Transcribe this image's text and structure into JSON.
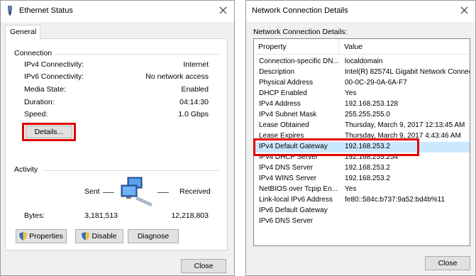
{
  "window1": {
    "title": "Ethernet Status",
    "tab": "General",
    "connection": {
      "heading": "Connection",
      "rows": [
        {
          "label": "IPv4 Connectivity:",
          "value": "Internet"
        },
        {
          "label": "IPv6 Connectivity:",
          "value": "No network access"
        },
        {
          "label": "Media State:",
          "value": "Enabled"
        },
        {
          "label": "Duration:",
          "value": "04:14:30"
        },
        {
          "label": "Speed:",
          "value": "1.0 Gbps"
        }
      ],
      "details_button": "Details..."
    },
    "activity": {
      "heading": "Activity",
      "sent_label": "Sent",
      "received_label": "Received",
      "bytes_label": "Bytes:",
      "bytes_sent": "3,181,513",
      "bytes_received": "12,218,803"
    },
    "buttons": {
      "properties": "Properties",
      "disable": "Disable",
      "diagnose": "Diagnose",
      "close": "Close"
    }
  },
  "window2": {
    "title": "Network Connection Details",
    "list_label": "Network Connection Details:",
    "columns": [
      "Property",
      "Value"
    ],
    "rows": [
      {
        "property": "Connection-specific DN...",
        "value": "localdomain"
      },
      {
        "property": "Description",
        "value": "Intel(R) 82574L Gigabit Network Connect"
      },
      {
        "property": "Physical Address",
        "value": "00-0C-29-0A-6A-F7"
      },
      {
        "property": "DHCP Enabled",
        "value": "Yes"
      },
      {
        "property": "IPv4 Address",
        "value": "192.168.253.128"
      },
      {
        "property": "IPv4 Subnet Mask",
        "value": "255.255.255.0"
      },
      {
        "property": "Lease Obtained",
        "value": "Thursday, March 9, 2017 12:13:45 AM"
      },
      {
        "property": "Lease Expires",
        "value": "Thursday, March 9, 2017 4:43:46 AM"
      },
      {
        "property": "IPv4 Default Gateway",
        "value": "192.168.253.2"
      },
      {
        "property": "IPv4 DHCP Server",
        "value": "192.168.253.254"
      },
      {
        "property": "IPv4 DNS Server",
        "value": "192.168.253.2"
      },
      {
        "property": "IPv4 WINS Server",
        "value": "192.168.253.2"
      },
      {
        "property": "NetBIOS over Tcpip En...",
        "value": "Yes"
      },
      {
        "property": "Link-local IPv6 Address",
        "value": "fe80::584c:b737:9a52:bd4b%11"
      },
      {
        "property": "IPv6 Default Gateway",
        "value": ""
      },
      {
        "property": "IPv6 DNS Server",
        "value": ""
      }
    ],
    "selected_row": "IPv4 Default Gateway",
    "close_button": "Close"
  },
  "colors": {
    "highlight_red": "#e00000",
    "selection_blue": "#cce8ff"
  }
}
